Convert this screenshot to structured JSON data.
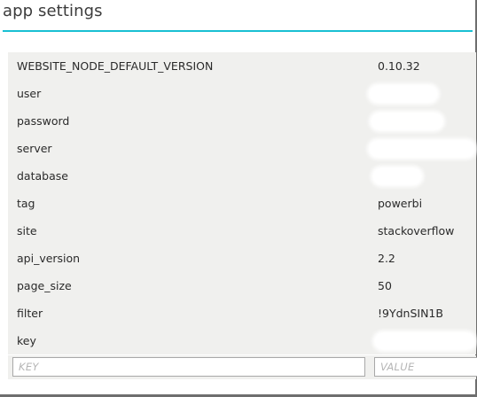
{
  "title": "app settings",
  "settings": [
    {
      "key": "WEBSITE_NODE_DEFAULT_VERSION",
      "value": "0.10.32",
      "redacted": false
    },
    {
      "key": "user",
      "value": "",
      "redacted": true
    },
    {
      "key": "password",
      "value": "",
      "redacted": true
    },
    {
      "key": "server",
      "value": "",
      "redacted": true
    },
    {
      "key": "database",
      "value": "",
      "redacted": true
    },
    {
      "key": "tag",
      "value": "powerbi",
      "redacted": false
    },
    {
      "key": "site",
      "value": "stackoverflow",
      "redacted": false
    },
    {
      "key": "api_version",
      "value": "2.2",
      "redacted": false
    },
    {
      "key": "page_size",
      "value": "50",
      "redacted": false
    },
    {
      "key": "filter",
      "value": "!9YdnSIN1B",
      "redacted": false
    },
    {
      "key": "key",
      "value": "",
      "redacted": true
    }
  ],
  "new_setting": {
    "key_placeholder": "KEY",
    "value_placeholder": "VALUE",
    "key_value": "",
    "value_value": ""
  },
  "colors": {
    "accent": "#19c0d3",
    "table_background": "#f0f0ee"
  }
}
